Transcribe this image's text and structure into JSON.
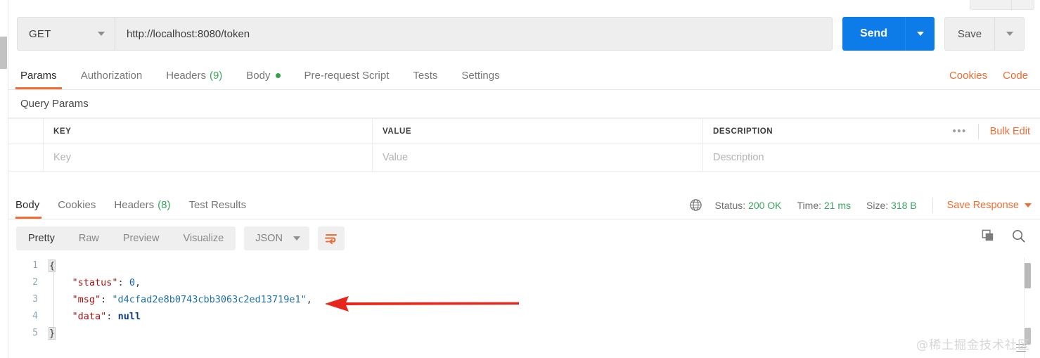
{
  "request": {
    "method": "GET",
    "url": "http://localhost:8080/token",
    "send_label": "Send",
    "save_label": "Save",
    "tabs": [
      {
        "label": "Params",
        "count": "",
        "active": true
      },
      {
        "label": "Authorization",
        "count": "",
        "active": false
      },
      {
        "label": "Headers",
        "count": "(9)",
        "active": false
      },
      {
        "label": "Body",
        "count": "",
        "dot": true,
        "active": false
      },
      {
        "label": "Pre-request Script",
        "count": "",
        "active": false
      },
      {
        "label": "Tests",
        "count": "",
        "active": false
      },
      {
        "label": "Settings",
        "count": "",
        "active": false
      }
    ],
    "links": {
      "cookies": "Cookies",
      "code": "Code"
    }
  },
  "query_params": {
    "section_title": "Query Params",
    "headers": {
      "key": "KEY",
      "value": "VALUE",
      "description": "DESCRIPTION"
    },
    "placeholders": {
      "key": "Key",
      "value": "Value",
      "description": "Description"
    },
    "ellipsis": "•••",
    "bulk_edit": "Bulk Edit"
  },
  "response": {
    "tabs": [
      {
        "label": "Body",
        "count": "",
        "active": true
      },
      {
        "label": "Cookies",
        "count": "",
        "active": false
      },
      {
        "label": "Headers",
        "count": "(8)",
        "active": false
      },
      {
        "label": "Test Results",
        "count": "",
        "active": false
      }
    ],
    "meta": {
      "status_label": "Status:",
      "status_value": "200 OK",
      "time_label": "Time:",
      "time_value": "21 ms",
      "size_label": "Size:",
      "size_value": "318 B",
      "save_response": "Save Response"
    },
    "toolbar": {
      "views": [
        {
          "label": "Pretty",
          "active": true
        },
        {
          "label": "Raw",
          "active": false
        },
        {
          "label": "Preview",
          "active": false
        },
        {
          "label": "Visualize",
          "active": false
        }
      ],
      "format": "JSON"
    },
    "body": {
      "lines": [
        {
          "no": "1",
          "indent": 0,
          "tokens": [
            {
              "t": "brace",
              "v": "{"
            }
          ]
        },
        {
          "no": "2",
          "indent": 1,
          "tokens": [
            {
              "t": "key",
              "v": "\"status\""
            },
            {
              "t": "punc",
              "v": ": "
            },
            {
              "t": "num",
              "v": "0"
            },
            {
              "t": "punc",
              "v": ","
            }
          ]
        },
        {
          "no": "3",
          "indent": 1,
          "tokens": [
            {
              "t": "key",
              "v": "\"msg\""
            },
            {
              "t": "punc",
              "v": ": "
            },
            {
              "t": "str",
              "v": "\"d4cfad2e8b0743cbb3063c2ed13719e1\""
            },
            {
              "t": "punc",
              "v": ","
            }
          ]
        },
        {
          "no": "4",
          "indent": 1,
          "tokens": [
            {
              "t": "key",
              "v": "\"data\""
            },
            {
              "t": "punc",
              "v": ": "
            },
            {
              "t": "null",
              "v": "null"
            }
          ]
        },
        {
          "no": "5",
          "indent": 0,
          "tokens": [
            {
              "t": "brace",
              "v": "}"
            }
          ]
        }
      ]
    }
  },
  "annotation": {
    "arrow_color": "#e8251b",
    "arrow_direction": "left"
  },
  "watermark": "@稀土掘金技术社区",
  "colors": {
    "accent_orange": "#ef6c33",
    "send_blue": "#0d7ce8",
    "status_green": "#3aa55d"
  }
}
